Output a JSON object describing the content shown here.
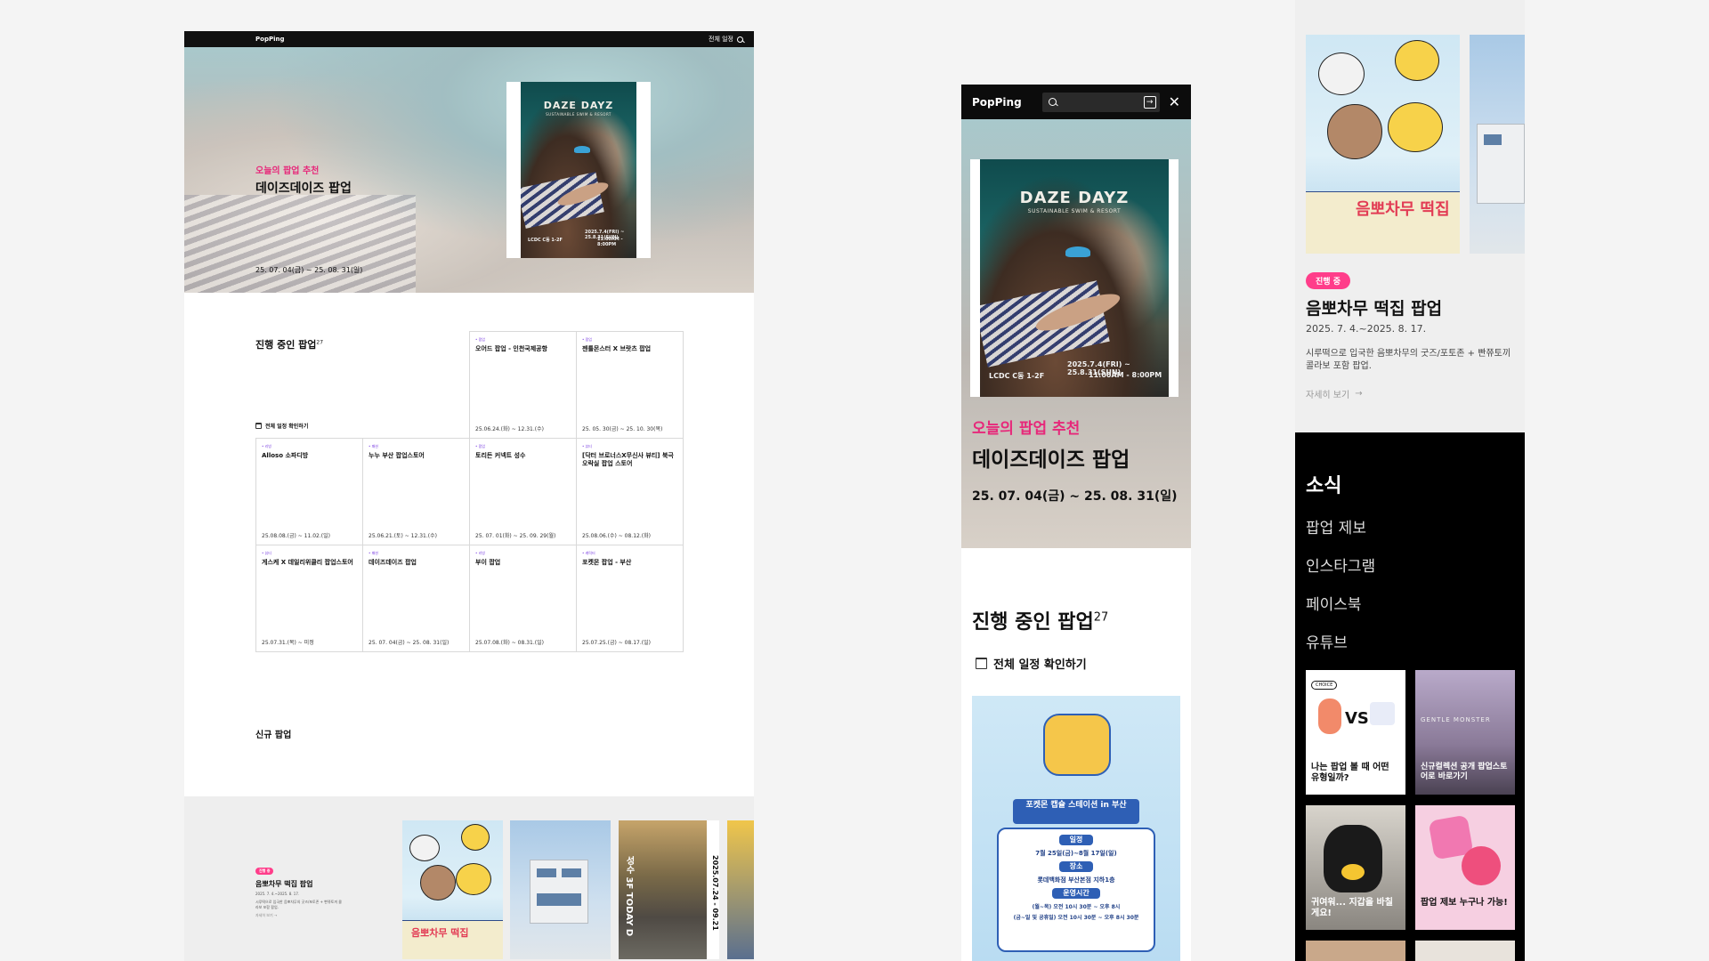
{
  "desktop": {
    "brand": "PopPing",
    "nav_all_schedule": "전체 일정",
    "hero": {
      "kicker": "오늘의 팝업 추천",
      "title": "데이즈데이즈 팝업",
      "date": "25. 07. 04(금) ~ 25. 08. 31(일)",
      "poster_brand": "DAZE DAYZ",
      "poster_sub": "SUSTAINABLE SWIM & RESORT",
      "poster_date": "2025.7.4(FRI) ~ 25.8.31(SUN)",
      "poster_time": "11:00AM - 8:00PM",
      "poster_place": "LCDC C동 1-2F"
    },
    "ongoing": {
      "title": "진행 중인 팝업",
      "count": "27",
      "calendar_link": "전체 일정 확인하기",
      "items": [
        {
          "tag": "• 팝업",
          "name": "오어드 팝업 - 인천국제공항",
          "date": "25.06.24.(화) ~ 12.31.(수)"
        },
        {
          "tag": "• 팝업",
          "name": "젠틀몬스터 X 브랏츠 팝업",
          "date": "25. 05. 30(금) ~ 25. 10. 30(목)"
        },
        {
          "tag": "• 리빙",
          "name": "Alloso 소파디방",
          "date": "25.08.08.(금) ~ 11.02.(일)"
        },
        {
          "tag": "• 패션",
          "name": "누누 부산 팝업스토어",
          "date": "25.06.21.(토) ~ 12.31.(수)"
        },
        {
          "tag": "• 팝업",
          "name": "토리든 커넥트 성수",
          "date": "25. 07. 01(화) ~ 25. 09. 29(월)"
        },
        {
          "tag": "• 뷰티",
          "name": "[닥터 브로너스X무신사 뷰티] 북극 오락실 팝업 스토어",
          "date": "25.08.06.(수) ~ 08.12.(화)"
        },
        {
          "tag": "• 뷰티",
          "name": "게스케 X 데일리위클리 팝업스토어",
          "date": "25.07.31.(목) ~ 미정"
        },
        {
          "tag": "• 패션",
          "name": "데이즈데이즈 팝업",
          "date": "25. 07. 04(금) ~ 25. 08. 31(일)"
        },
        {
          "tag": "• 리빙",
          "name": "부이 팝업",
          "date": "25.07.08.(화) ~ 08.31.(일)"
        },
        {
          "tag": "• 캐릭터",
          "name": "포켓몬 팝업 - 부산",
          "date": "25.07.25.(금) ~ 08.17.(일)"
        }
      ]
    },
    "new_popups": {
      "title": "신규 팝업",
      "badge": "진행 중",
      "name": "음뽀차무 떡집 팝업",
      "date": "2025. 7. 4.~2025. 8. 17.",
      "desc": "시루떡으로 입국한 음뽀차무의 굿즈/포토존 + 빤쮸토끼 콜라보 포함 팝업.",
      "more": "자세히 보기 →",
      "thumb_film_text": "성수 3F TODAY D",
      "thumb_film_date": "2025.07.24 - 09.21"
    }
  },
  "mobile": {
    "brand": "PopPing",
    "hero": {
      "kicker": "오늘의 팝업 추천",
      "title": "데이즈데이즈 팝업",
      "date": "25. 07. 04(금) ~ 25. 08. 31(일)"
    },
    "ongoing_title": "진행 중인 팝업",
    "ongoing_count": "27",
    "calendar_link": "전체 일정 확인하기",
    "pokemon_poster": {
      "banner": "포켓몬 캡슐 스테이션 in 부산",
      "label_period": "일정",
      "period": "7월 25일(금)~8월 17일(일)",
      "label_place": "장소",
      "place": "롯데백화점 부산본점 지하1층",
      "label_hours": "운영시간",
      "hours1": "(월~목) 오전 10시 30분 ~ 오후 8시",
      "hours2": "(금~일 및 공휴일) 오전 10시 30분 ~ 오후 8시 30분"
    }
  },
  "side": {
    "badge": "진행 중",
    "title": "음뽀차무 떡집 팝업",
    "date": "2025. 7. 4.~2025. 8. 17.",
    "desc": "시루떡으로 입국한 음뽀차무의 굿즈/포토존 + 빤쮸토끼 콜라보 포함 팝업.",
    "more": "자세히 보기",
    "poster_title": "음뽀차무 떡집",
    "news": {
      "title": "소식",
      "links": [
        "팝업 제보",
        "인스타그램",
        "페이스북",
        "유튜브"
      ],
      "tiles": [
        {
          "caption": "나는 팝업 볼 때 어떤 유형일까?",
          "top": "CHOICE"
        },
        {
          "caption": "신규컬렉션 공개 팝업스토어로 바로가기",
          "top": "GENTLE MONSTER"
        },
        {
          "caption": "귀여워... 지갑을 바칠게요!",
          "top": ""
        },
        {
          "caption": "팝업 제보 누구나 가능!",
          "top": ""
        }
      ]
    }
  },
  "colors": {
    "accent_pink": "#e7287a",
    "badge_pink": "#ff3d8a",
    "nav_black": "#0c0c0c"
  }
}
